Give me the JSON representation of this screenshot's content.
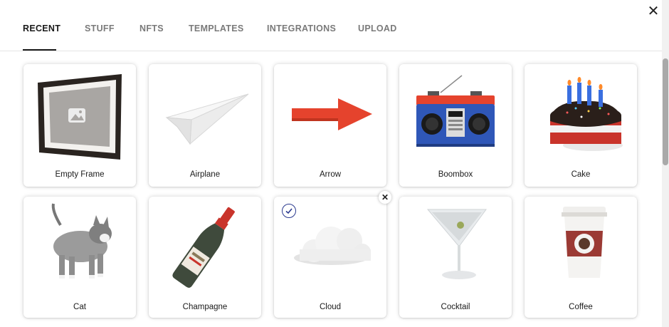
{
  "tabs": [
    {
      "label": "RECENT",
      "active": true
    },
    {
      "label": "STUFF",
      "active": false
    },
    {
      "label": "NFTS",
      "active": false
    },
    {
      "label": "TEMPLATES",
      "active": false
    },
    {
      "label": "INTEGRATIONS",
      "active": false
    },
    {
      "label": "UPLOAD",
      "active": false
    }
  ],
  "close_icon": "close-icon",
  "items": [
    {
      "label": "Empty Frame",
      "icon": "empty-frame-icon"
    },
    {
      "label": "Airplane",
      "icon": "paper-airplane-icon"
    },
    {
      "label": "Arrow",
      "icon": "red-arrow-icon"
    },
    {
      "label": "Boombox",
      "icon": "boombox-icon"
    },
    {
      "label": "Cake",
      "icon": "birthday-cake-icon"
    },
    {
      "label": "Cat",
      "icon": "cat-icon"
    },
    {
      "label": "Champagne",
      "icon": "champagne-bottle-icon"
    },
    {
      "label": "Cloud",
      "icon": "cloud-icon",
      "selected": true,
      "removable": true
    },
    {
      "label": "Cocktail",
      "icon": "martini-glass-icon"
    },
    {
      "label": "Coffee",
      "icon": "coffee-cup-icon"
    }
  ],
  "colors": {
    "active_tab": "#1a1a1a",
    "inactive_tab": "#7a7a7a",
    "selection_check": "#2b3a8f",
    "arrow_red": "#e5432d",
    "boombox_blue": "#2f57b8"
  }
}
